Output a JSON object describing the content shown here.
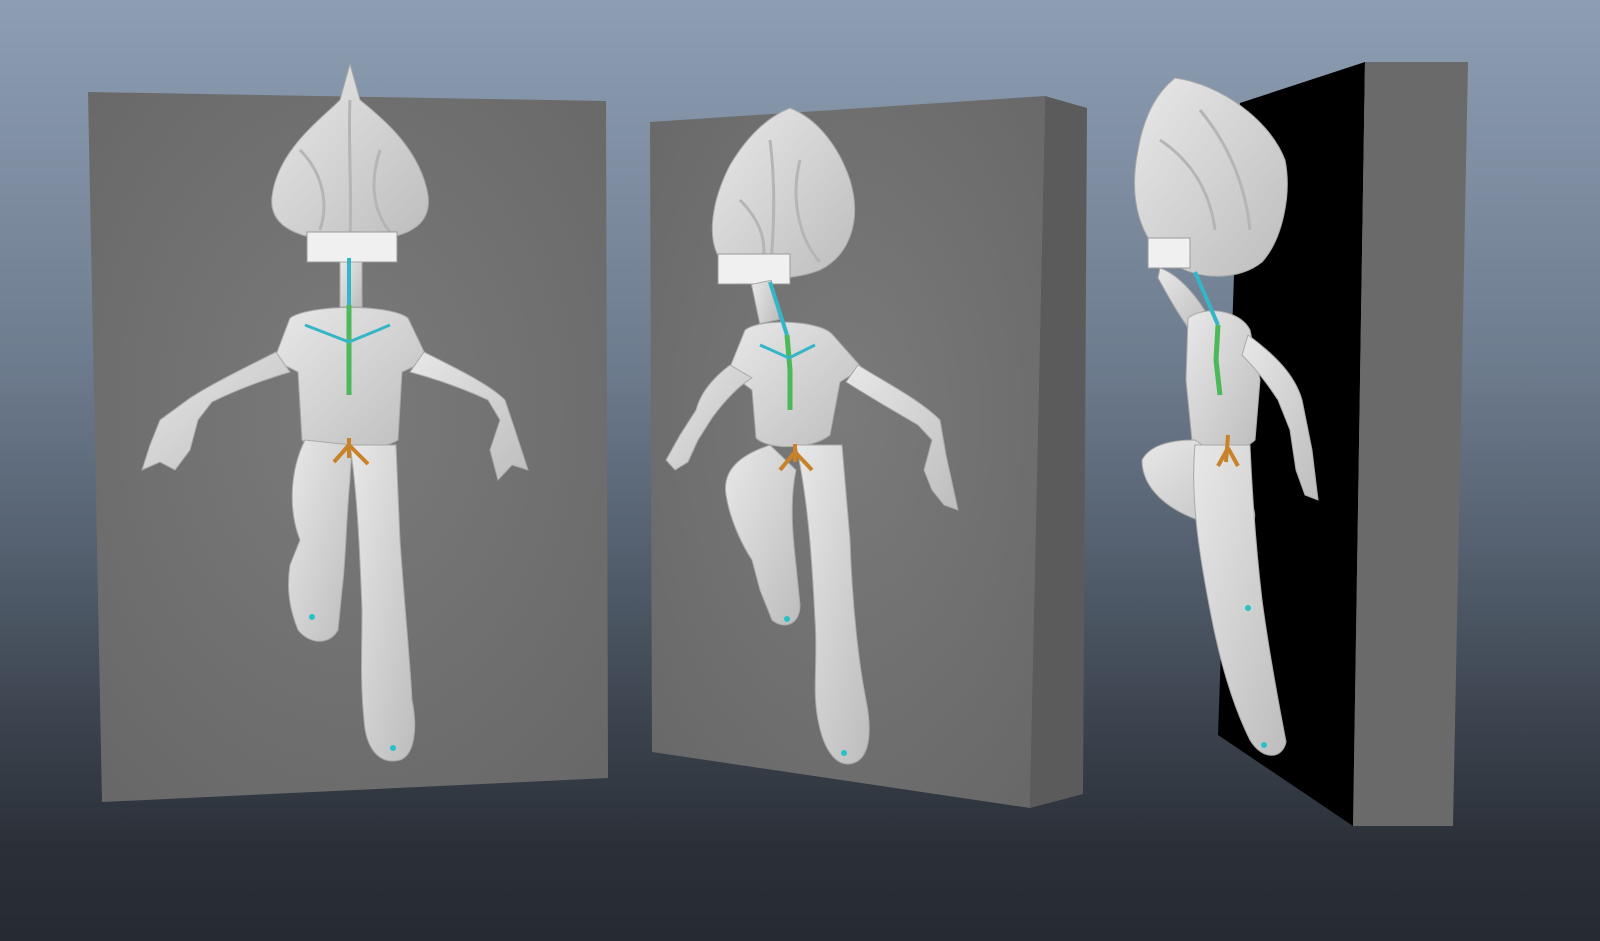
{
  "viewport": {
    "background_top": "#8d9eb3",
    "background_bottom": "#262a31"
  },
  "scene": {
    "panel_colors": {
      "face": "#6f6f6f",
      "side": "#5b5b5b",
      "back": "#000000"
    },
    "character_color": "#dcdcdc",
    "rig_colors": {
      "head_joints": "#34b6c8",
      "spine_joints": "#4cb85a",
      "root_control": "#c8822a",
      "foot_locator": "#2ac0c8"
    },
    "views": [
      {
        "name": "front-view"
      },
      {
        "name": "three-quarter-view"
      },
      {
        "name": "side-view"
      }
    ]
  }
}
